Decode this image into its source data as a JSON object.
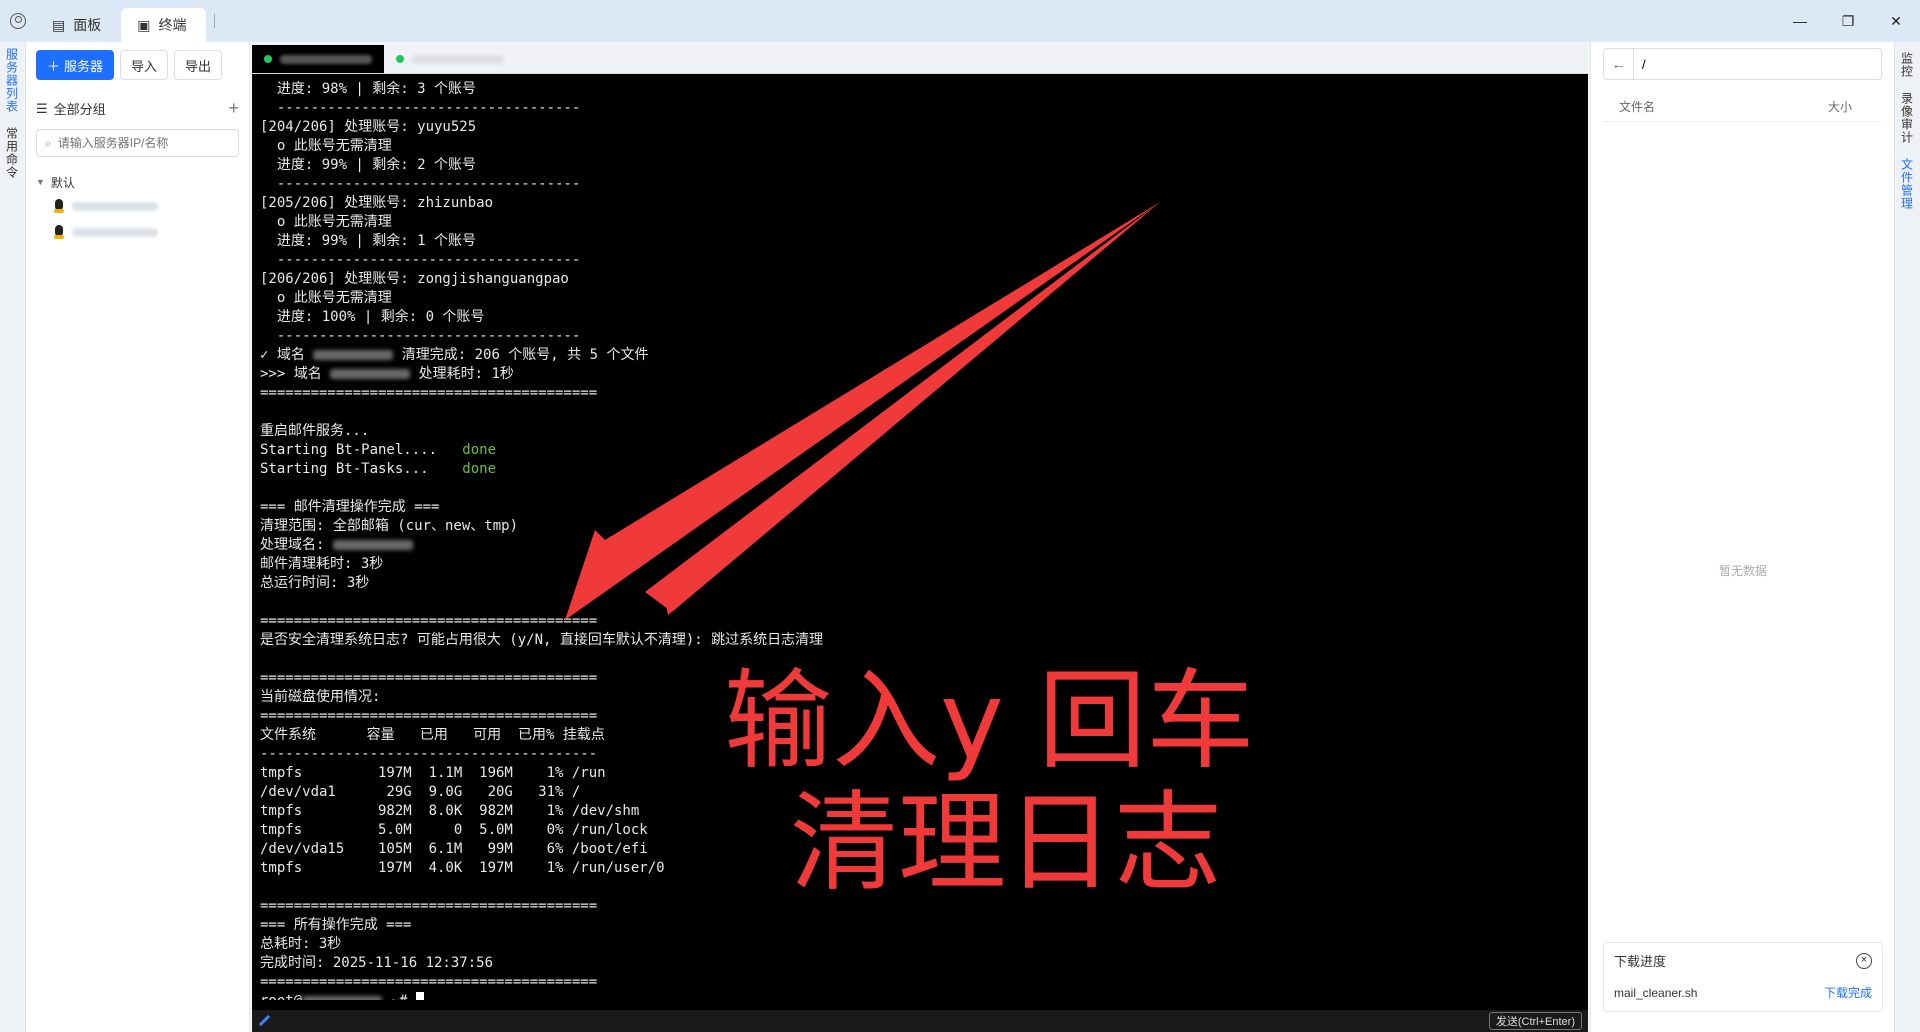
{
  "titlebar": {
    "tabs": [
      {
        "label": "面板",
        "icon": "panel-icon"
      },
      {
        "label": "终端",
        "icon": "terminal-icon"
      }
    ],
    "controls": {
      "minimize": "—",
      "restore": "❐",
      "close": "✕"
    }
  },
  "left_rail": {
    "items": [
      "服务器列表",
      "常用命令"
    ]
  },
  "server_panel": {
    "add_label": "服务器",
    "import_label": "导入",
    "export_label": "导出",
    "group_label": "全部分组",
    "search_placeholder": "请输入服务器IP/名称",
    "tree_group": "默认"
  },
  "terminal": {
    "lines": [
      "  进度: 98% | 剩余: 3 个账号",
      "  ------------------------------------",
      "[204/206] 处理账号: yuyu525",
      "  o 此账号无需清理",
      "  进度: 99% | 剩余: 2 个账号",
      "  ------------------------------------",
      "[205/206] 处理账号: zhizunbao",
      "  o 此账号无需清理",
      "  进度: 99% | 剩余: 1 个账号",
      "  ------------------------------------",
      "[206/206] 处理账号: zongjishanguangpao",
      "  o 此账号无需清理",
      "  进度: 100% | 剩余: 0 个账号",
      "  ------------------------------------",
      "✓ 域名 ██ 清理完成: 206 个账号, 共 5 个文件",
      ">>> 域名 ██ 处理耗时: 1秒",
      "========================================",
      "",
      "重启邮件服务...",
      "Starting Bt-Panel....   %%done%%",
      "Starting Bt-Tasks...    %%done%%",
      "",
      "=== 邮件清理操作完成 ===",
      "清理范围: 全部邮箱 (cur、new、tmp)",
      "处理域名: ██",
      "邮件清理耗时: 3秒",
      "总运行时间: 3秒",
      "",
      "========================================",
      "是否安全清理系统日志? 可能占用很大 (y/N, 直接回车默认不清理): 跳过系统日志清理",
      "",
      "========================================",
      "当前磁盘使用情况:",
      "========================================",
      "文件系统      容量   已用   可用  已用% 挂载点",
      "----------------------------------------",
      "tmpfs         197M  1.1M  196M    1% /run",
      "/dev/vda1      29G  9.0G   20G   31% /",
      "tmpfs         982M  8.0K  982M    1% /dev/shm",
      "tmpfs         5.0M     0  5.0M    0% /run/lock",
      "/dev/vda15    105M  6.1M   99M    6% /boot/efi",
      "tmpfs         197M  4.0K  197M    1% /run/user/0",
      "",
      "========================================",
      "=== 所有操作完成 ===",
      "总耗时: 3秒",
      "完成时间: 2025-11-16 12:37:56",
      "========================================",
      "root@██ ~# "
    ],
    "send_label": "发送(Ctrl+Enter)",
    "done_color": "#6bbf3a"
  },
  "annotation": {
    "line1": "输入y  回车",
    "line2": "清理日志",
    "color": "#f03a3a"
  },
  "file_panel": {
    "path_value": "/",
    "col_name": "文件名",
    "col_size": "大小",
    "empty_text": "暂无数据",
    "download_title": "下载进度",
    "download_file": "mail_cleaner.sh",
    "download_status": "下载完成"
  },
  "right_rail": {
    "items": [
      "监控",
      "录像审计",
      "文件管理"
    ]
  },
  "colors": {
    "accent": "#1f6fff",
    "titlebar": "#dde8f7",
    "terminal_bg": "#000000"
  }
}
